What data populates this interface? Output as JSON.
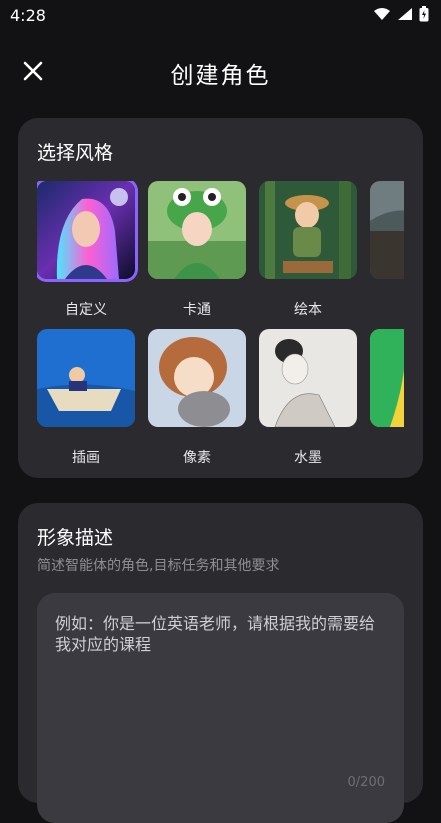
{
  "status": {
    "time": "4:28"
  },
  "header": {
    "title": "创建角色"
  },
  "style_section": {
    "title": "选择风格",
    "items": [
      {
        "label": "自定义",
        "selected": true
      },
      {
        "label": "卡通"
      },
      {
        "label": "绘本"
      },
      {
        "label": ""
      },
      {
        "label": "插画"
      },
      {
        "label": "像素"
      },
      {
        "label": "水墨"
      },
      {
        "label": ""
      }
    ]
  },
  "description_section": {
    "title": "形象描述",
    "subtitle": "简述智能体的角色,目标任务和其他要求",
    "placeholder": "例如：你是一位英语老师，请根据我的需要给我对应的课程",
    "counter": "0/200"
  },
  "colors": {
    "accent": "#8b64ff",
    "card": "#2a2a2f",
    "background": "#121214"
  }
}
